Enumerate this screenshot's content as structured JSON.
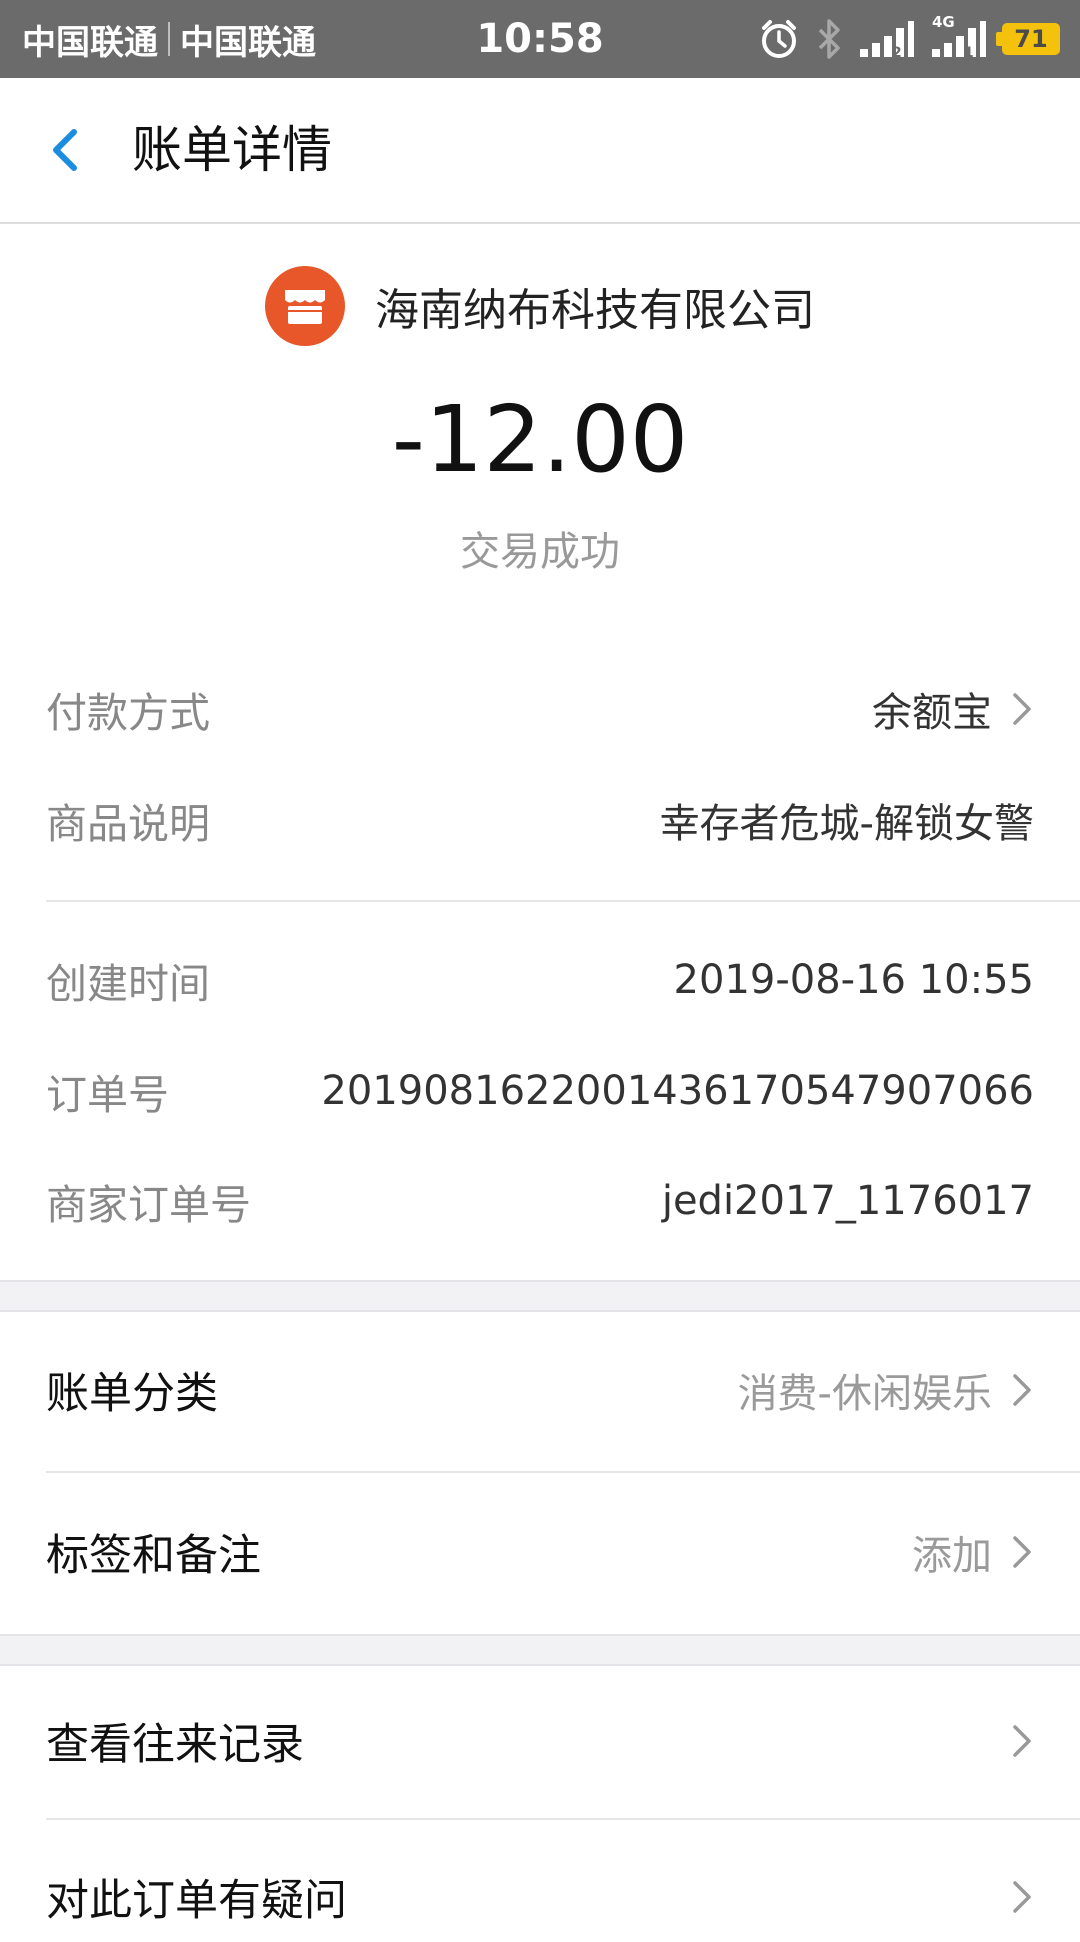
{
  "status_bar": {
    "carrier1": "中国联通",
    "carrier2": "中国联通",
    "time": "10:58",
    "battery": "71",
    "network_label": "4G",
    "icons": [
      "alarm-icon",
      "bluetooth-icon",
      "signal-icon",
      "signal-icon"
    ]
  },
  "nav": {
    "title": "账单详情",
    "back_icon": "chevron-left-icon"
  },
  "header": {
    "merchant_name": "海南纳布科技有限公司",
    "merchant_icon": "store-icon",
    "amount": "-12.00",
    "status": "交易成功"
  },
  "details": [
    {
      "label": "付款方式",
      "value": "余额宝"
    },
    {
      "label": "商品说明",
      "value": "幸存者危城-解锁女警"
    },
    {
      "label": "创建时间",
      "value": "2019-08-16 10:55"
    },
    {
      "label": "订单号",
      "value": "2019081622001436170547907066"
    },
    {
      "label": "商家订单号",
      "value": "jedi2017_1176017"
    }
  ],
  "category": {
    "label": "账单分类",
    "value": "消费-休闲娱乐"
  },
  "tags": {
    "label": "标签和备注",
    "value": "添加"
  },
  "history": {
    "label": "查看往来记录"
  },
  "question": {
    "label": "对此订单有疑问"
  },
  "colors": {
    "accent": "#1b8de0",
    "merchant_icon_bg": "#e8572a",
    "battery": "#f4c20d",
    "status_bar": "#6b6b6b"
  }
}
